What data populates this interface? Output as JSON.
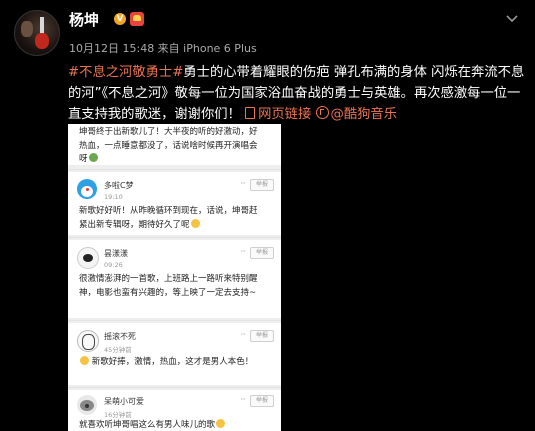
{
  "post": {
    "author": "杨坤",
    "vip_badge": "V",
    "meta": "10月12日 15:48 来自 iPhone 6 Plus",
    "hashtag": "#不息之河敬勇士#",
    "text_1": "勇士的心带着耀眼的伤疤 弹孔布满的身体 闪烁在奔流不息的河”《不息之河》敬每一位为国家浴血奋战的勇士与英雄。再次感激每一位一直支持我的歌迷，谢谢你们！",
    "link_label": "网页链接",
    "music_label": "@酷狗音乐"
  },
  "colors": {
    "background": "#000000",
    "accent": "#eb7350",
    "meta_text": "#aaaaaa"
  },
  "screenshot": {
    "comments": [
      {
        "text": "坤哥终于出新歌儿了！大半夜的听的好激动，好热血，一点睡意都没了，话说啥时候再开演唱会呀",
        "avatar_icon": ""
      },
      {
        "name": "多啦C梦",
        "time": "19:10",
        "report_label": "举报",
        "more_label": "···",
        "text": "新歌好好听！从昨晚循环到现在，话说，坤哥赶紧出新专辑呀，期待好久了呢",
        "avatar_icon": "doraemon-avatar"
      },
      {
        "name": "昙漾漾",
        "time": "09:26",
        "report_label": "举报",
        "more_label": "···",
        "text": "很激情澎湃的一首歌，上班路上一路听来特别醒神，电影也蛮有兴趣的，等上映了一定去支持~",
        "avatar_icon": "sheep-avatar"
      },
      {
        "name": "摇滚不死",
        "time": "45分钟前",
        "report_label": "举报",
        "more_label": "···",
        "text": "新歌好捧，激情，热血，这才是男人本色！",
        "avatar_icon": "sketch-avatar"
      },
      {
        "name": "呆萌小可爱",
        "time": "16分钟前",
        "report_label": "举报",
        "more_label": "···",
        "text": "就喜欢听坤哥唱这么有男人味儿的歌",
        "avatar_icon": "koala-avatar"
      }
    ]
  }
}
